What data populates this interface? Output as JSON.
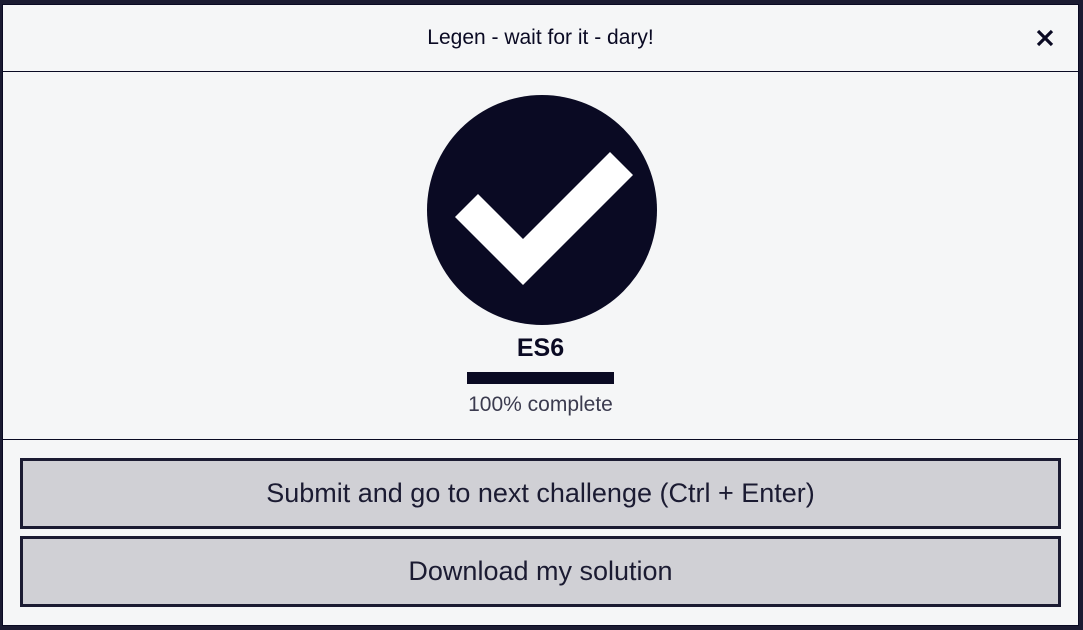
{
  "modal": {
    "title": "Legen - wait for it - dary!",
    "close_icon": "close-icon"
  },
  "certification": {
    "icon": "check-circle-icon",
    "title": "ES6",
    "progress_percent": 100,
    "progress_text": "100% complete"
  },
  "actions": {
    "submit_label": "Submit and go to next challenge (Ctrl + Enter)",
    "download_label": "Download my solution"
  },
  "colors": {
    "modal_background": "#f5f6f7",
    "primary_dark": "#0a0a23",
    "button_background": "#d0d0d5"
  }
}
